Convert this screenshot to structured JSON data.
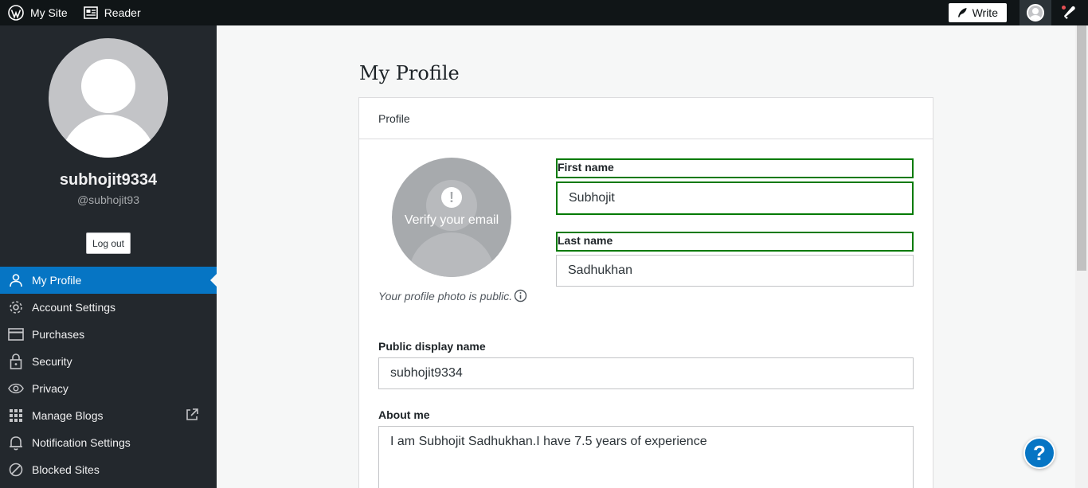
{
  "topbar": {
    "my_site": "My Site",
    "reader": "Reader",
    "write": "Write"
  },
  "sidebar": {
    "username": "subhojit9334",
    "handle": "@subhojit93",
    "logout": "Log out",
    "items": [
      {
        "label": "My Profile",
        "icon": "person-icon",
        "active": true
      },
      {
        "label": "Account Settings",
        "icon": "gear-icon"
      },
      {
        "label": "Purchases",
        "icon": "credit-card-icon"
      },
      {
        "label": "Security",
        "icon": "lock-icon"
      },
      {
        "label": "Privacy",
        "icon": "eye-icon"
      },
      {
        "label": "Manage Blogs",
        "icon": "grid-icon"
      },
      {
        "label": "Notification Settings",
        "icon": "bell-icon"
      },
      {
        "label": "Blocked Sites",
        "icon": "block-icon"
      }
    ]
  },
  "main": {
    "title": "My Profile",
    "card_header": "Profile",
    "gravatar_text": "Verify your email",
    "photo_note": "Your profile photo is public.",
    "first_name_label": "First name",
    "first_name_value": "Subhojit",
    "last_name_label": "Last name",
    "last_name_value": "Sadhukhan",
    "display_name_label": "Public display name",
    "display_name_value": "subhojit9334",
    "about_label": "About me",
    "about_value": "I am Subhojit Sadhukhan.I have 7.5 years of experience"
  },
  "help": "?",
  "colors": {
    "topbar": "#101517",
    "sidebar": "#23282d",
    "active": "#0675c4",
    "focus": "#007a00"
  }
}
